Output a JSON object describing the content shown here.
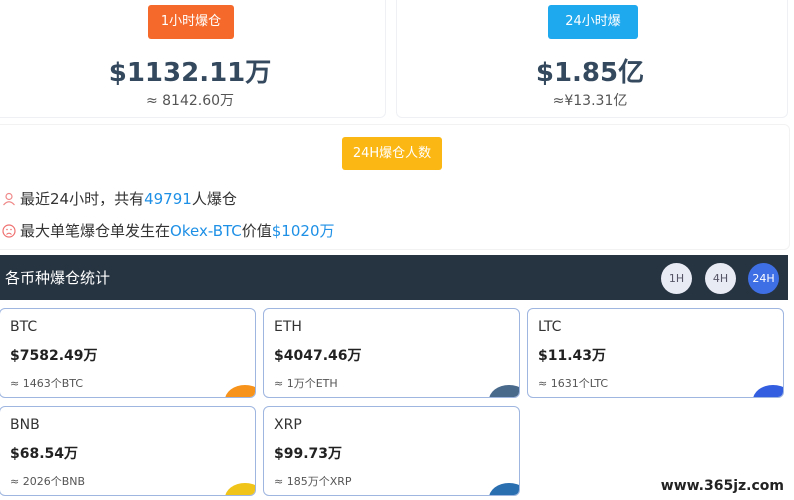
{
  "summary": {
    "hour": {
      "label": "1小时爆仓",
      "value": "$1132.11万",
      "approx": "≈ 8142.60万",
      "color": "#f56a2a"
    },
    "day": {
      "label": "24小时爆仓",
      "value": "$1.85亿",
      "approx": "≈¥13.31亿",
      "color": "#1ea8ee"
    }
  },
  "people": {
    "label": "24H爆仓人数",
    "color": "#fbb713",
    "line1_prefix": "最近24小时，共有",
    "line1_count": "49791",
    "line1_suffix": "人爆仓",
    "line2_prefix": "最大单笔爆仓单发生在",
    "line2_exchange": "Okex-BTC",
    "line2_mid": "价值",
    "line2_value": "$1020万"
  },
  "coins_section": {
    "title": "各币种爆仓统计",
    "timeframes": [
      "1H",
      "4H",
      "24H"
    ],
    "active_timeframe": "24H"
  },
  "coins": [
    {
      "symbol": "BTC",
      "value": "$7582.49万",
      "amount": "≈ 1463个BTC",
      "accent": "#f7931a"
    },
    {
      "symbol": "ETH",
      "value": "$4047.46万",
      "amount": "≈ 1万个ETH",
      "accent": "#4a6a8c"
    },
    {
      "symbol": "LTC",
      "value": "$11.43万",
      "amount": "≈ 1631个LTC",
      "accent": "#345ee0"
    },
    {
      "symbol": "BNB",
      "value": "$68.54万",
      "amount": "≈ 2026个BNB",
      "accent": "#f0c419"
    },
    {
      "symbol": "XRP",
      "value": "$99.73万",
      "amount": "≈ 185万个XRP",
      "accent": "#2a6fb0"
    }
  ],
  "watermark": "www.365jz.com"
}
